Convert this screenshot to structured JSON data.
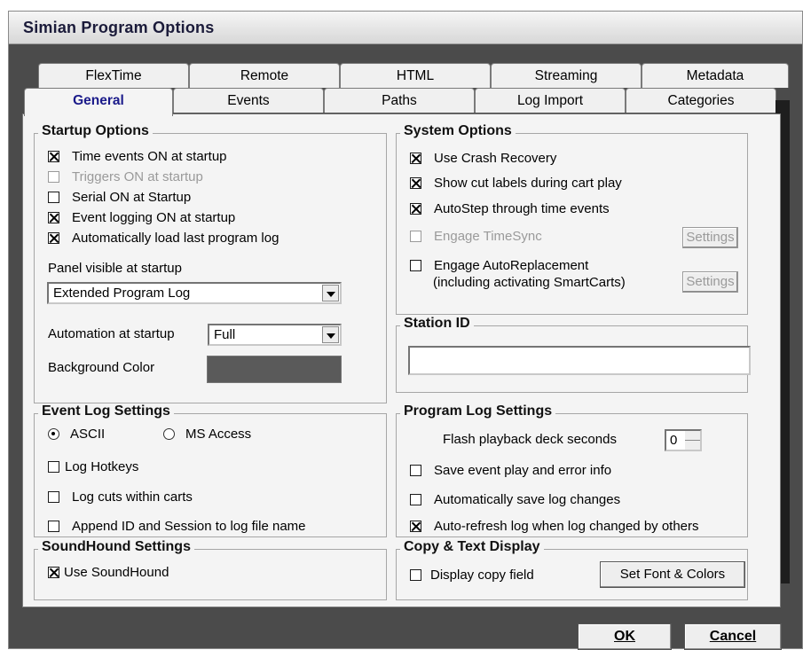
{
  "window": {
    "title": "Simian Program Options"
  },
  "tabs": {
    "row1": [
      "FlexTime",
      "Remote",
      "HTML",
      "Streaming",
      "Metadata"
    ],
    "row2": [
      "General",
      "Events",
      "Paths",
      "Log Import",
      "Categories"
    ],
    "active": "General"
  },
  "startup": {
    "title": "Startup Options",
    "options": [
      {
        "label": "Time events ON at startup",
        "checked": true,
        "disabled": false
      },
      {
        "label": "Triggers ON at startup",
        "checked": false,
        "disabled": true
      },
      {
        "label": "Serial ON at Startup",
        "checked": false,
        "disabled": false
      },
      {
        "label": "Event logging ON at startup",
        "checked": true,
        "disabled": false
      },
      {
        "label": "Automatically load last program log",
        "checked": true,
        "disabled": false
      }
    ],
    "panel_label": "Panel visible at startup",
    "panel_value": "Extended Program Log",
    "automation_label": "Automation at startup",
    "automation_value": "Full",
    "bg_label": "Background Color",
    "bg_color": "#5a5a5a"
  },
  "event_log": {
    "title": "Event Log Settings",
    "radio_ascii": "ASCII",
    "radio_access": "MS Access",
    "selected": "ASCII",
    "log_hotkeys": "Log Hotkeys",
    "log_cuts": "Log cuts within carts",
    "append_id": "Append ID and Session to log file name"
  },
  "soundhound": {
    "title": "SoundHound Settings",
    "use": "Use SoundHound",
    "checked": true
  },
  "system": {
    "title": "System Options",
    "options": [
      {
        "label": "Use Crash Recovery",
        "checked": true,
        "disabled": false
      },
      {
        "label": "Show cut labels during cart play",
        "checked": true,
        "disabled": false
      },
      {
        "label": "AutoStep through time events",
        "checked": true,
        "disabled": false
      },
      {
        "label": "Engage TimeSync",
        "checked": false,
        "disabled": true
      }
    ],
    "auto_line1": "Engage AutoReplacement",
    "auto_line2": "(including activating SmartCarts)",
    "settings": "Settings"
  },
  "station": {
    "title": "Station ID",
    "value": ""
  },
  "program_log": {
    "title": "Program Log Settings",
    "flash_label": "Flash playback deck seconds",
    "flash_value": "0",
    "save_event": "Save event play and error info",
    "auto_save": "Automatically save log changes",
    "auto_refresh": "Auto-refresh log when log changed by others"
  },
  "copy_text": {
    "title": "Copy & Text Display",
    "display_copy": "Display copy field",
    "set_font": "Set Font & Colors"
  },
  "buttons": {
    "ok": "OK",
    "cancel": "Cancel"
  }
}
